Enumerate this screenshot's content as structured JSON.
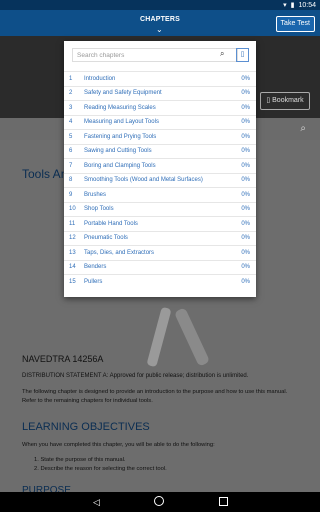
{
  "status_bar": {
    "time": "10:54"
  },
  "app_bar": {
    "title": "CHAPTERS",
    "take_test_label": "Take Test"
  },
  "banner": {
    "bookmark_label": "Bookmark"
  },
  "content": {
    "doc_title": "Tools An",
    "doc_number": "NAVEDTRA 14256A",
    "distribution_label": "DISTRIBUTION STATEMENT A: Approved for public release; distribution is unlimited.",
    "intro_text": "The following chapter is designed to provide an introduction to the purpose and how to use this manual. Refer to the remaining chapters for individual tools.",
    "learning_objectives_heading": "LEARNING OBJECTIVES",
    "learning_objectives_intro": "When you have completed this chapter, you will be able to do the following:",
    "objectives": [
      "1. State the purpose of this manual.",
      "2. Describe the reason for selecting the correct tool."
    ],
    "purpose_heading": "PURPOSE"
  },
  "dropdown": {
    "search_placeholder": "Search chapters",
    "chapters": [
      {
        "num": "1",
        "title": "Introduction",
        "pct": "0%"
      },
      {
        "num": "2",
        "title": "Safety and Safety Equipment",
        "pct": "0%"
      },
      {
        "num": "3",
        "title": "Reading Measuring Scales",
        "pct": "0%"
      },
      {
        "num": "4",
        "title": "Measuring and Layout Tools",
        "pct": "0%"
      },
      {
        "num": "5",
        "title": "Fastening and Prying Tools",
        "pct": "0%"
      },
      {
        "num": "6",
        "title": "Sawing and Cutting Tools",
        "pct": "0%"
      },
      {
        "num": "7",
        "title": "Boring and Clamping Tools",
        "pct": "0%"
      },
      {
        "num": "8",
        "title": "Smoothing Tools (Wood and Metal Surfaces)",
        "pct": "0%"
      },
      {
        "num": "9",
        "title": "Brushes",
        "pct": "0%"
      },
      {
        "num": "10",
        "title": "Shop Tools",
        "pct": "0%"
      },
      {
        "num": "11",
        "title": "Portable Hand Tools",
        "pct": "0%"
      },
      {
        "num": "12",
        "title": "Pneumatic Tools",
        "pct": "0%"
      },
      {
        "num": "13",
        "title": "Taps, Dies, and Extractors",
        "pct": "0%"
      },
      {
        "num": "14",
        "title": "Benders",
        "pct": "0%"
      },
      {
        "num": "15",
        "title": "Pullers",
        "pct": "0%"
      }
    ]
  }
}
